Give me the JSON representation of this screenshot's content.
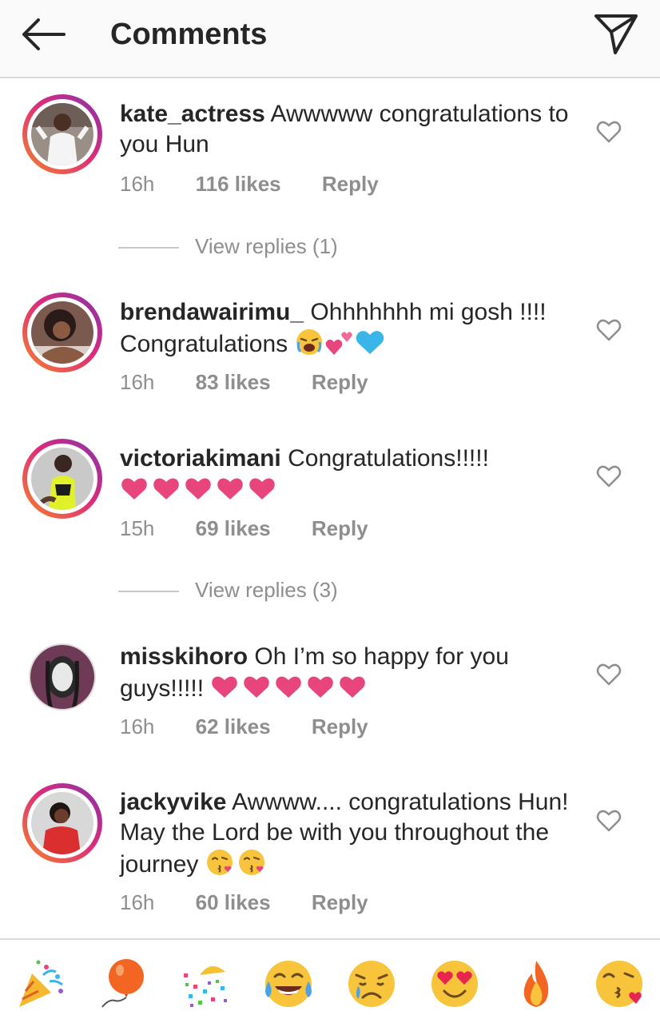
{
  "header": {
    "title": "Comments",
    "back_icon": "arrow-left-icon",
    "send_icon": "paper-plane-icon"
  },
  "comments": [
    {
      "username": "kate_actress",
      "text": "Awwwww congratulations to you Hun",
      "time": "16h",
      "likes": "116 likes",
      "reply": "Reply",
      "avatar_ring": "story"
    },
    {
      "username": "brendawairimu_",
      "text": "Ohhhhhhh mi gosh !!!! Congratulations",
      "emojis": [
        "crying-face",
        "two-hearts",
        "blue-heart"
      ],
      "time": "16h",
      "likes": "83 likes",
      "reply": "Reply",
      "avatar_ring": "story"
    },
    {
      "username": "victoriakimani",
      "text": "Congratulations!!!!!",
      "emojis": [
        "heart",
        "heart",
        "heart",
        "heart",
        "heart"
      ],
      "time": "15h",
      "likes": "69 likes",
      "reply": "Reply",
      "avatar_ring": "story"
    },
    {
      "username": "misskihoro",
      "text": "Oh I’m so happy for you guys!!!!!",
      "emojis": [
        "heart",
        "heart",
        "heart",
        "heart",
        "heart"
      ],
      "time": "16h",
      "likes": "62 likes",
      "reply": "Reply",
      "avatar_ring": "none"
    },
    {
      "username": "jackyvike",
      "text": "Awwww.... congratulations Hun! May the Lord be with you throughout the journey",
      "emojis": [
        "kissing-face",
        "kissing-face"
      ],
      "time": "16h",
      "likes": "60 likes",
      "reply": "Reply",
      "avatar_ring": "story"
    }
  ],
  "view_replies": [
    "View replies (1)",
    "View replies (3)"
  ],
  "emoji_bar": [
    "party-popper",
    "balloon",
    "confetti",
    "tears-of-joy",
    "crying-face",
    "heart-eyes",
    "fire",
    "face-blowing-kiss"
  ],
  "colors": {
    "heart_pink": "#e8457c",
    "blue_heart": "#3ab5ea",
    "muted_text": "#8e8e8e",
    "story_ring_start": "#f58529",
    "story_ring_end": "#8134af"
  }
}
